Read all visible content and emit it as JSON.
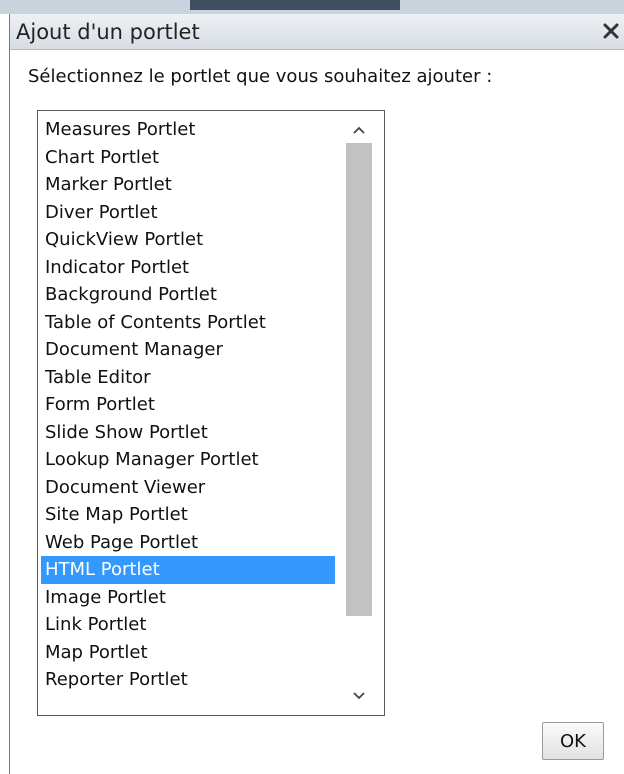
{
  "dialog": {
    "title": "Ajout d'un portlet",
    "close_icon": "close-icon",
    "prompt": "Sélectionnez le portlet que vous souhaitez ajouter :",
    "ok_label": "OK"
  },
  "portlet_list": {
    "items": [
      "Measures Portlet",
      "Chart Portlet",
      "Marker Portlet",
      "Diver Portlet",
      "QuickView Portlet",
      "Indicator Portlet",
      "Background Portlet",
      "Table of Contents Portlet",
      "Document Manager",
      "Table Editor",
      "Form Portlet",
      "Slide Show Portlet",
      "Lookup Manager Portlet",
      "Document Viewer",
      "Site Map Portlet",
      "Web Page Portlet",
      "HTML Portlet",
      "Image Portlet",
      "Link Portlet",
      "Map Portlet",
      "Reporter Portlet"
    ],
    "selected_index": 16,
    "scroll": {
      "up_icon": "chevron-up-icon",
      "down_icon": "chevron-down-icon",
      "thumb_fraction": 0.88
    }
  },
  "colors": {
    "selection": "#3399ff",
    "selection_text": "#ffffff",
    "scroll_thumb": "#c2c2c2"
  }
}
